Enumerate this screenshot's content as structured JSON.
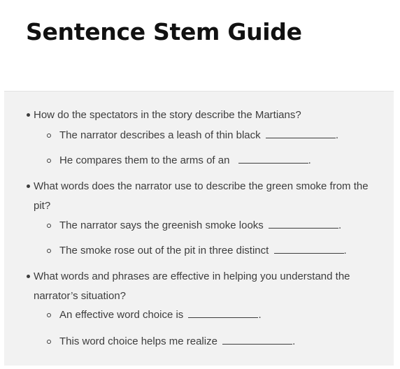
{
  "title": "Sentence Stem Guide",
  "questions": [
    {
      "text": "How do the spectators in the story describe the Martians?",
      "stems": [
        {
          "text": "The narrator describes a leash of thin black",
          "end": "."
        },
        {
          "text": "He compares them to the arms of an",
          "end": "."
        }
      ]
    },
    {
      "text": "What words does the narrator use to describe the green smoke from the pit?",
      "stems": [
        {
          "text": "The narrator says the greenish smoke looks",
          "end": "."
        },
        {
          "text": "The smoke rose out of the pit in three distinct",
          "end": "."
        }
      ]
    },
    {
      "text": "What words and phrases are effective in helping you understand the narrator’s situation?",
      "stems": [
        {
          "text": "An effective word choice is",
          "end": "."
        },
        {
          "text": "This word choice helps me realize",
          "end": "."
        }
      ]
    }
  ]
}
